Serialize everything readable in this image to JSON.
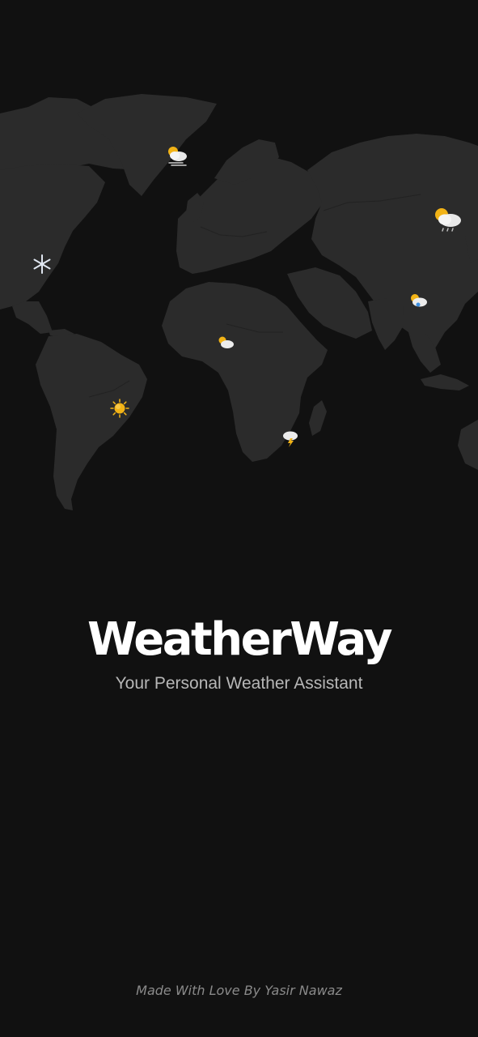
{
  "splash": {
    "app_name": "WeatherWay",
    "tagline": "Your Personal Weather Assistant",
    "credit": "Made With Love By Yasir Nawaz"
  },
  "map": {
    "markers": [
      {
        "region": "greenland",
        "icon": "partly-cloudy-windy-icon"
      },
      {
        "region": "north-america",
        "icon": "snowflake-icon"
      },
      {
        "region": "central-africa",
        "icon": "partly-cloudy-icon"
      },
      {
        "region": "south-america",
        "icon": "sun-icon"
      },
      {
        "region": "southern-africa",
        "icon": "thunderstorm-icon"
      },
      {
        "region": "northern-asia",
        "icon": "partly-cloudy-rain-icon"
      },
      {
        "region": "south-asia",
        "icon": "partly-cloudy-rain-icon"
      }
    ]
  },
  "theme": {
    "background": "#111111",
    "land": "#2b2b2b",
    "title": "#ffffff",
    "tagline": "#b7b7b7",
    "credit": "#8a8a8a",
    "sun": "#f2b316"
  }
}
